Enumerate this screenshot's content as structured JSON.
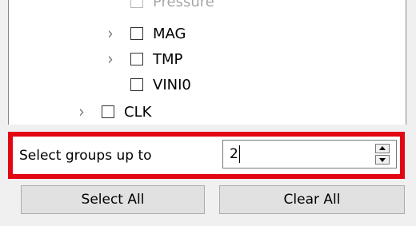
{
  "tree": {
    "items": [
      {
        "label": "Pressure",
        "has_children": false,
        "faded": true
      },
      {
        "label": "MAG",
        "has_children": true
      },
      {
        "label": "TMP",
        "has_children": true
      },
      {
        "label": "VINI0",
        "has_children": false
      },
      {
        "label": "CLK",
        "has_children": true
      }
    ]
  },
  "groups": {
    "label": "Select groups up to",
    "value": "2"
  },
  "buttons": {
    "select_all": "Select All",
    "clear_all": "Clear All"
  },
  "colors": {
    "highlight": "#e30613"
  }
}
